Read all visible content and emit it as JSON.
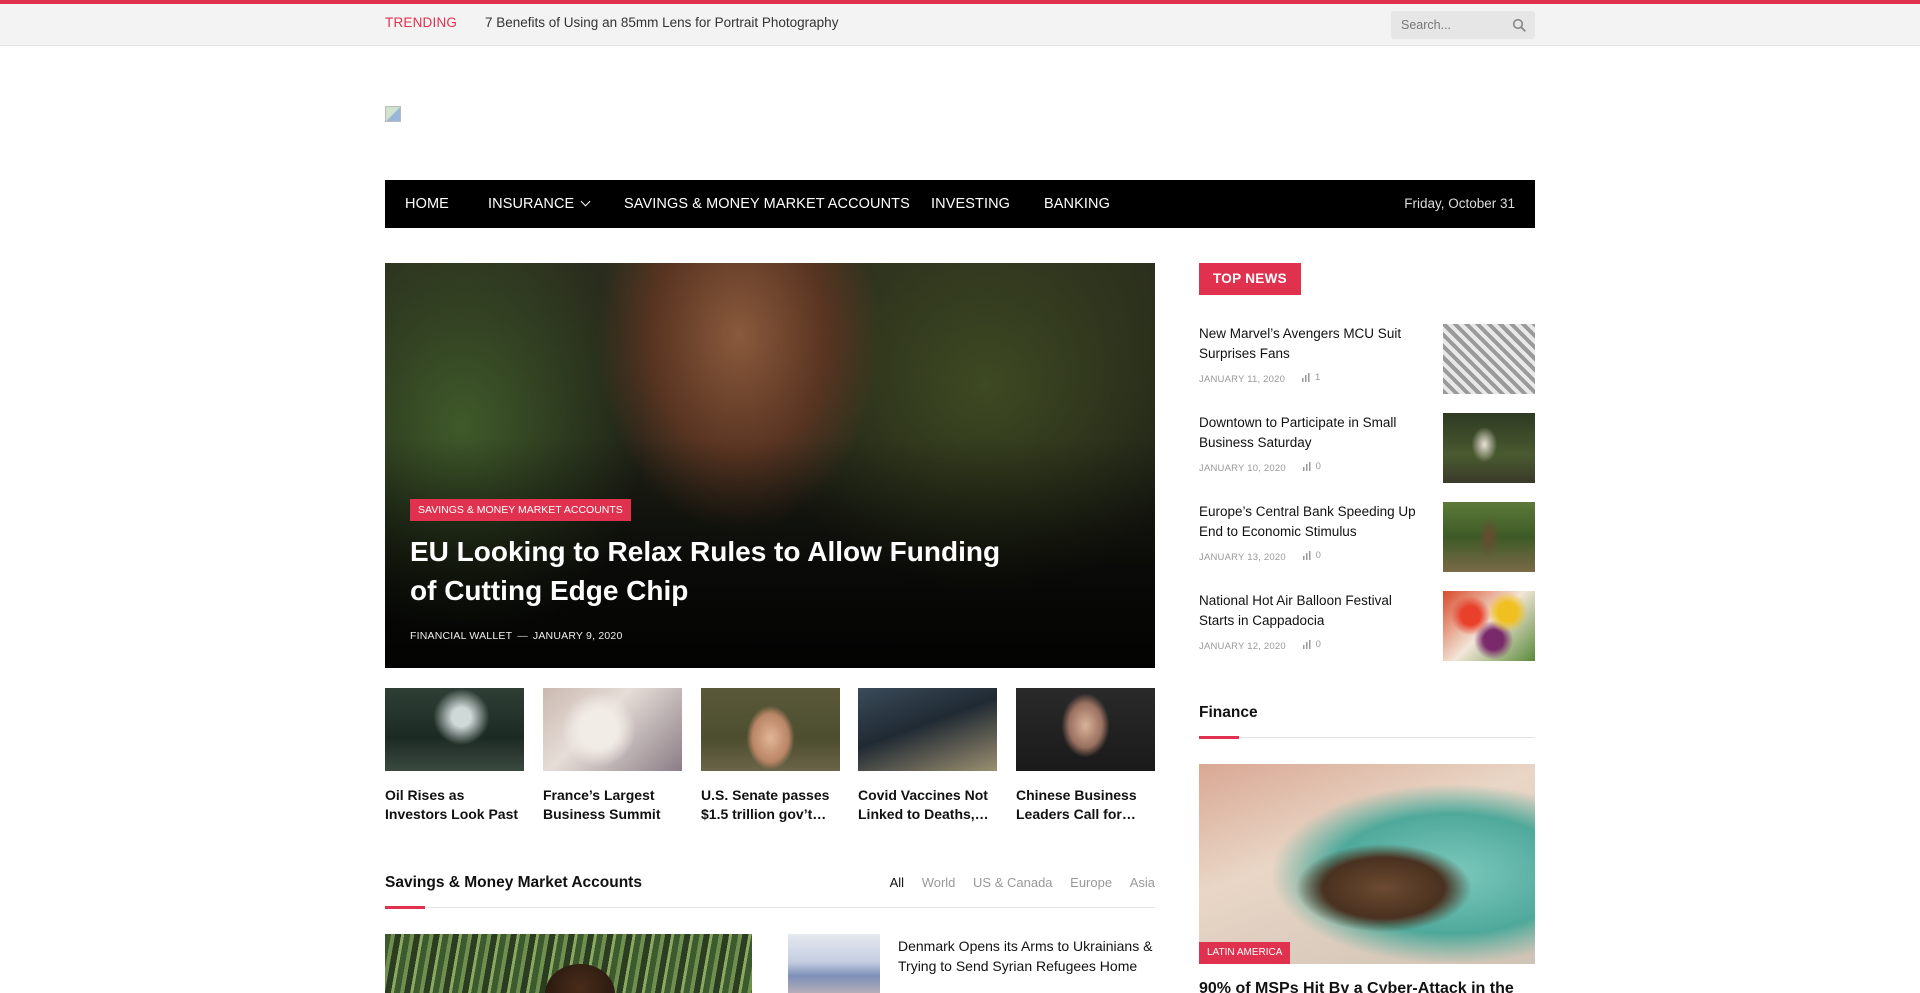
{
  "topbar": {
    "trending_label": "TRENDING",
    "trending_title": "7 Benefits of Using an 85mm Lens for Portrait Photography",
    "search_placeholder": "Search...",
    "search_icon": "search-icon"
  },
  "nav": {
    "items": [
      {
        "label": "HOME"
      },
      {
        "label": "INSURANCE",
        "dropdown": true
      },
      {
        "label": "SAVINGS & MONEY MARKET ACCOUNTS"
      },
      {
        "label": "INVESTING"
      },
      {
        "label": "BANKING"
      }
    ],
    "date": "Friday, October 31"
  },
  "hero": {
    "category": "SAVINGS & MONEY MARKET ACCOUNTS",
    "title": "EU Looking to Relax Rules to Allow Funding of Cutting Edge Chip",
    "author": "FINANCIAL WALLET",
    "separator": "—",
    "date": "JANUARY 9, 2020"
  },
  "cards": [
    {
      "title": "Oil Rises as Investors Look Past Possible…"
    },
    {
      "title": "France’s Largest Business Summit to…"
    },
    {
      "title": "U.S. Senate passes $1.5 trillion gov’t…"
    },
    {
      "title": "Covid Vaccines Not Linked to Deaths,…"
    },
    {
      "title": "Chinese Business Leaders Call for…"
    }
  ],
  "savings_section": {
    "title": "Savings & Money Market Accounts",
    "tabs": [
      "All",
      "World",
      "US & Canada",
      "Europe",
      "Asia"
    ],
    "active_tab": "All",
    "side_article_title": "Denmark Opens its Arms to Ukrainians & Trying to Send Syrian Refugees Home"
  },
  "top_news": {
    "label": "TOP NEWS",
    "items": [
      {
        "title": "New Marvel’s Avengers MCU Suit Surprises Fans",
        "date": "JANUARY 11, 2020",
        "views": "1"
      },
      {
        "title": "Downtown to Participate in Small Business Saturday",
        "date": "JANUARY 10, 2020",
        "views": "0"
      },
      {
        "title": "Europe’s Central Bank Speeding Up End to Economic Stimulus",
        "date": "JANUARY 13, 2020",
        "views": "0"
      },
      {
        "title": "National Hot Air Balloon Festival Starts in Cappadocia",
        "date": "JANUARY 12, 2020",
        "views": "0"
      }
    ]
  },
  "finance": {
    "title": "Finance",
    "category": "LATIN AMERICA",
    "headline": "90% of MSPs Hit By a Cyber-Attack in the"
  },
  "colors": {
    "accent": "#e0314f",
    "nav_bg": "#000000",
    "topbar_bg": "#f3f3f3"
  }
}
